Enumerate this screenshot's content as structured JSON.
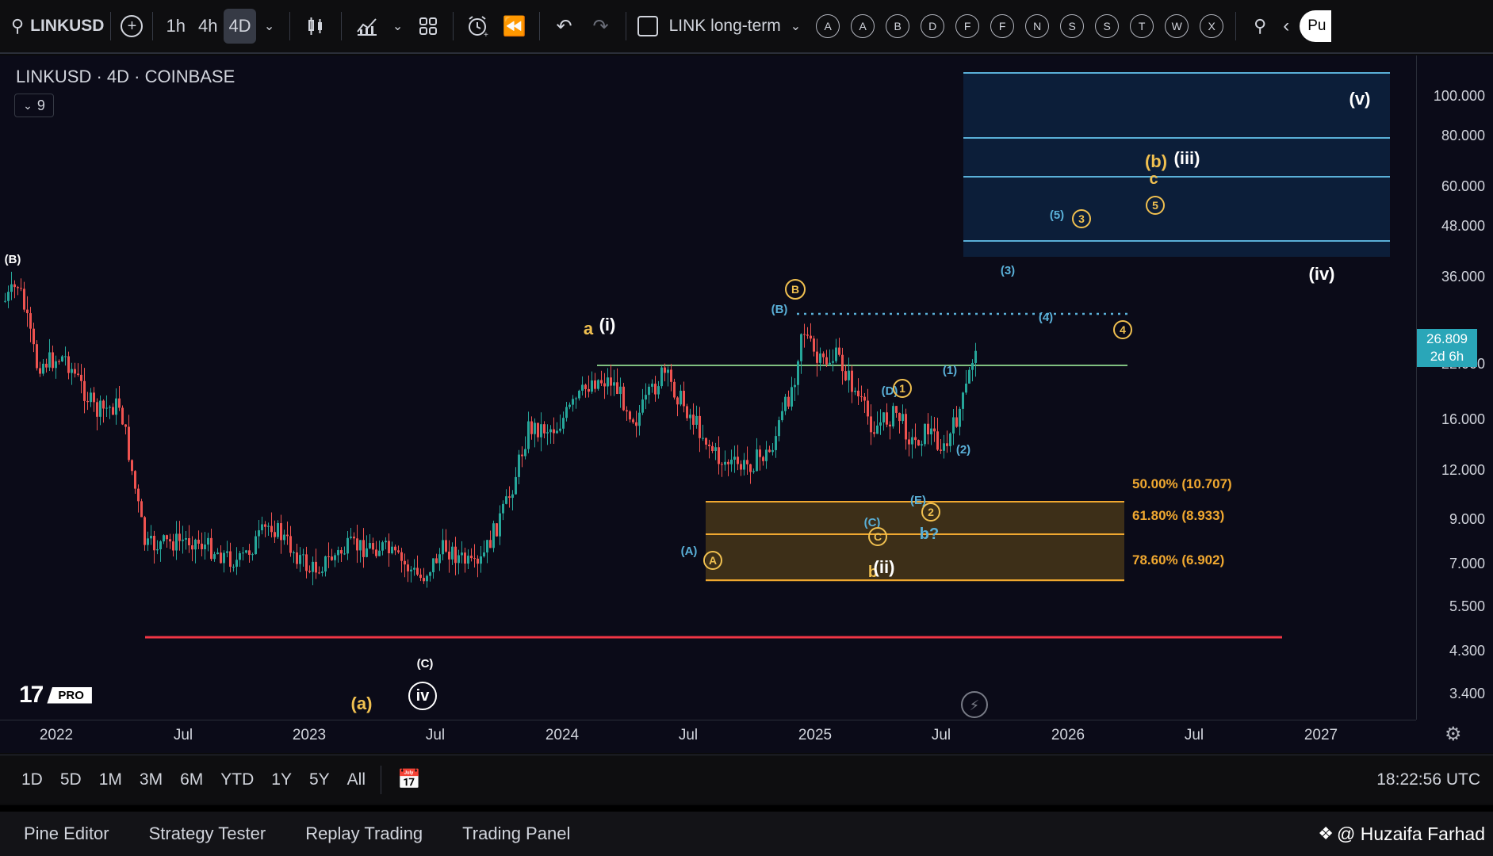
{
  "toolbar": {
    "symbol": "LINKUSD",
    "timeframes": [
      "1h",
      "4h",
      "4D"
    ],
    "layout_name": "LINK long-term",
    "letter_buttons": [
      "A",
      "A",
      "B",
      "D",
      "F",
      "F",
      "N",
      "S",
      "S",
      "T",
      "W",
      "X"
    ],
    "publish_label": "Pu"
  },
  "chart": {
    "title": "LINKUSD · 4D · COINBASE",
    "indicator_count": "9",
    "logo_badge": "PRO",
    "price_labels": [
      "100.000",
      "80.000",
      "60.000",
      "48.000",
      "36.000",
      "22.000",
      "16.000",
      "12.000",
      "9.000",
      "7.000",
      "5.500",
      "4.300",
      "3.400"
    ],
    "current_price": "26.809",
    "current_countdown": "2d 6h",
    "time_labels": [
      "2022",
      "Jul",
      "2023",
      "Jul",
      "2024",
      "Jul",
      "2025",
      "Jul",
      "2026",
      "Jul",
      "2027"
    ],
    "fib_levels": [
      {
        "label": "50.00% (10.707)"
      },
      {
        "label": "61.80% (8.933)"
      },
      {
        "label": "78.60% (6.902)"
      }
    ],
    "colors": {
      "up": "#26a69a",
      "down": "#ef5350",
      "support": "#f23645",
      "resistance": "#80c080",
      "fib": "#f0a830",
      "box": "#5ab0d8"
    },
    "wave_labels": {
      "B_left": "(B)",
      "a_i": "a",
      "i": "(i)",
      "B_circ": "B",
      "B_paren": "(B)",
      "b_paren": "(b)",
      "iii": "(iii)",
      "c": "c",
      "v": "(v)",
      "iv_right": "(iv)",
      "five": "(5)",
      "three_paren": "(3)",
      "four_paren": "(4)",
      "D": "(D)",
      "one_paren": "(1)",
      "two_paren": "(2)",
      "E": "(E)",
      "b_q": "b?",
      "C_paren": "(C)",
      "A_paren": "(A)",
      "ii": "(ii)",
      "b_ii": "b",
      "C_bottom": "(C)",
      "iv_bottom": "iv",
      "a_bottom": "(a)",
      "circ3": "3",
      "circ5": "5",
      "circ4": "4",
      "circ1": "1",
      "circ2": "2",
      "circC": "C",
      "circA": "A"
    }
  },
  "rangebar": {
    "ranges": [
      "1D",
      "5D",
      "1M",
      "3M",
      "6M",
      "YTD",
      "1Y",
      "5Y",
      "All"
    ],
    "clock": "18:22:56 UTC"
  },
  "panels": {
    "tabs": [
      "Pine Editor",
      "Strategy Tester",
      "Replay Trading",
      "Trading Panel"
    ],
    "watermark": "@ Huzaifa Farhad"
  }
}
